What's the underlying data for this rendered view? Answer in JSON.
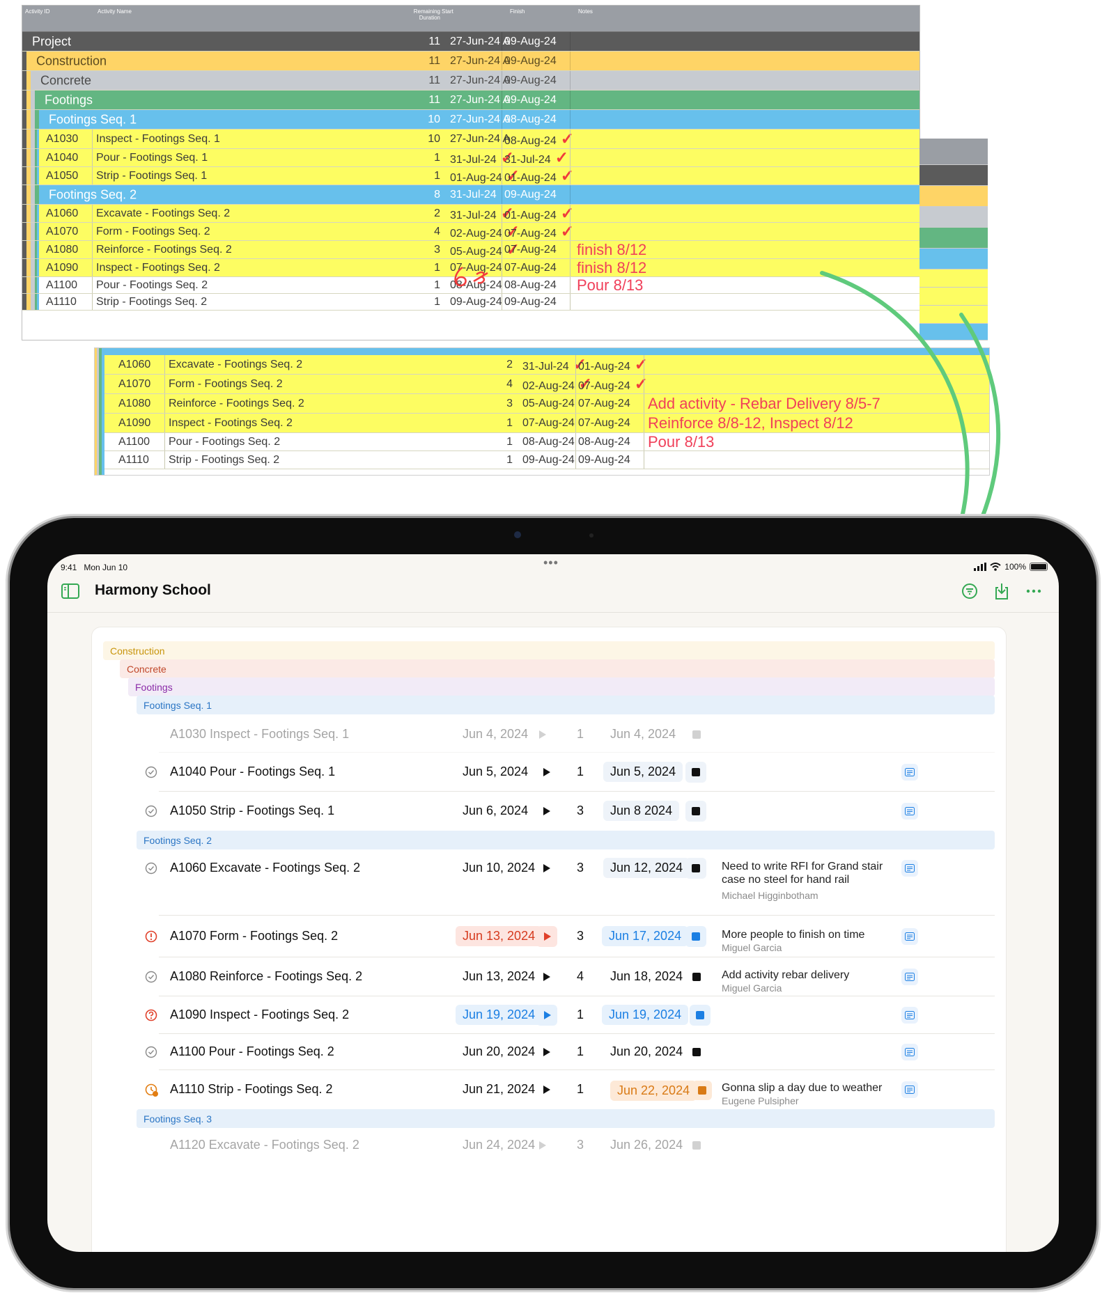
{
  "sheet_top": {
    "headers": [
      "Activity ID",
      "Activity Name",
      "Remaining Duration",
      "Start",
      "Finish",
      "Notes"
    ],
    "rows": [
      {
        "kind": "wbs",
        "name": "Project",
        "dur": "11",
        "start": "27-Jun-24 A",
        "finish": "09-Aug-24",
        "bg": "#5b5b5b",
        "fg": "#ffffff",
        "indent": 0
      },
      {
        "kind": "wbs",
        "name": "Construction",
        "dur": "11",
        "start": "27-Jun-24 A",
        "finish": "09-Aug-24",
        "bg": "#fed466",
        "fg": "#5a4a20",
        "indent": 1
      },
      {
        "kind": "wbs",
        "name": "Concrete",
        "dur": "11",
        "start": "27-Jun-24 A",
        "finish": "09-Aug-24",
        "bg": "#c7cbd0",
        "fg": "#4a4a4a",
        "indent": 2
      },
      {
        "kind": "wbs",
        "name": "Footings",
        "dur": "11",
        "start": "27-Jun-24 A",
        "finish": "09-Aug-24",
        "bg": "#63b682",
        "fg": "#ffffff",
        "indent": 3
      },
      {
        "kind": "wbs",
        "name": "Footings Seq. 1",
        "dur": "10",
        "start": "27-Jun-24 A",
        "finish": "08-Aug-24",
        "bg": "#67c0ec",
        "fg": "#ffffff",
        "indent": 4
      },
      {
        "kind": "act",
        "id": "A1030",
        "name": "Inspect - Footings Seq. 1",
        "dur": "10",
        "start": "27-Jun-24 A",
        "finish": "08-Aug-24",
        "sc": false,
        "fc": true,
        "note": ""
      },
      {
        "kind": "act",
        "id": "A1040",
        "name": "Pour - Footings Seq. 1",
        "dur": "1",
        "start": "31-Jul-24",
        "finish": "31-Jul-24",
        "sc": true,
        "fc": true,
        "note": ""
      },
      {
        "kind": "act",
        "id": "A1050",
        "name": "Strip - Footings Seq. 1",
        "dur": "1",
        "start": "01-Aug-24",
        "finish": "01-Aug-24",
        "sc": true,
        "fc": true,
        "note": ""
      },
      {
        "kind": "wbs",
        "name": "Footings Seq. 2",
        "dur": "8",
        "start": "31-Jul-24",
        "finish": "09-Aug-24",
        "bg": "#67c0ec",
        "fg": "#ffffff",
        "indent": 4
      },
      {
        "kind": "act",
        "id": "A1060",
        "name": "Excavate - Footings Seq. 2",
        "dur": "2",
        "start": "31-Jul-24",
        "finish": "01-Aug-24",
        "sc": true,
        "fc": true,
        "note": ""
      },
      {
        "kind": "act",
        "id": "A1070",
        "name": "Form - Footings Seq. 2",
        "dur": "4",
        "start": "02-Aug-24",
        "finish": "07-Aug-24",
        "sc": true,
        "fc": true,
        "note": ""
      },
      {
        "kind": "act",
        "id": "A1080",
        "name": "Reinforce - Footings Seq. 2",
        "dur": "3",
        "start": "05-Aug-24",
        "finish": "07-Aug-24",
        "sc": true,
        "fc": false,
        "note": "finish 8/12",
        "hand": "6"
      },
      {
        "kind": "act",
        "id": "A1090",
        "name": "Inspect - Footings Seq. 2",
        "dur": "1",
        "start": "07-Aug-24",
        "finish": "07-Aug-24",
        "sc": false,
        "fc": false,
        "note": "finish 8/12"
      },
      {
        "kind": "act",
        "id": "A1100",
        "name": "Pour - Footings Seq. 2",
        "dur": "1",
        "start": "08-Aug-24",
        "finish": "08-Aug-24",
        "sc": false,
        "fc": false,
        "note": "Pour 8/13",
        "white": true
      },
      {
        "kind": "act",
        "id": "A1110",
        "name": "Strip - Footings Seq. 2",
        "dur": "1",
        "start": "09-Aug-24",
        "finish": "09-Aug-24",
        "sc": false,
        "fc": false,
        "note": "",
        "white": true
      }
    ]
  },
  "sheet_bottom": {
    "rows": [
      {
        "id": "A1060",
        "name": "Excavate - Footings Seq. 2",
        "dur": "2",
        "start": "31-Jul-24",
        "finish": "01-Aug-24",
        "sc": true,
        "fc": true,
        "note": ""
      },
      {
        "id": "A1070",
        "name": "Form - Footings Seq. 2",
        "dur": "4",
        "start": "02-Aug-24",
        "finish": "07-Aug-24",
        "sc": true,
        "fc": true,
        "note": ""
      },
      {
        "id": "A1080",
        "name": "Reinforce - Footings Seq. 2",
        "dur": "3",
        "start": "05-Aug-24",
        "finish": "07-Aug-24",
        "sc": false,
        "fc": false,
        "note": "Add activity - Rebar Delivery 8/5-7"
      },
      {
        "id": "A1090",
        "name": "Inspect - Footings Seq. 2",
        "dur": "1",
        "start": "07-Aug-24",
        "finish": "07-Aug-24",
        "sc": false,
        "fc": false,
        "note": "Reinforce 8/8-12, Inspect 8/12"
      },
      {
        "id": "A1100",
        "name": "Pour - Footings Seq. 2",
        "dur": "1",
        "start": "08-Aug-24",
        "finish": "08-Aug-24",
        "sc": false,
        "fc": false,
        "note": "Pour 8/13",
        "white": true
      },
      {
        "id": "A1110",
        "name": "Strip - Footings Seq. 2",
        "dur": "1",
        "start": "09-Aug-24",
        "finish": "09-Aug-24",
        "sc": false,
        "fc": false,
        "note": "",
        "white": true
      }
    ]
  },
  "strip_colors": [
    "#9a9ea4",
    "#5b5b5b",
    "#fed466",
    "#c7cbd0",
    "#63b682",
    "#67c0ec",
    "#fdfd62",
    "#fdfd62",
    "#fdfd62",
    "#67c0ec"
  ],
  "ipad": {
    "status": {
      "time": "9:41",
      "date": "Mon Jun 10",
      "battery": "100%"
    },
    "title": "Harmony School",
    "bands": [
      {
        "label": "Construction",
        "bg": "#fdf6e6",
        "fg": "#c8950c"
      },
      {
        "label": "Concrete",
        "bg": "#fbeae6",
        "fg": "#c0472a"
      },
      {
        "label": "Footings",
        "bg": "#f2ebf7",
        "fg": "#8a2ba8"
      },
      {
        "label": "Footings Seq. 1",
        "bg": "#e6f0fa",
        "fg": "#2a75c4"
      },
      {
        "label": "Footings Seq. 2",
        "bg": "#e6f0fa",
        "fg": "#2a75c4"
      },
      {
        "label": "Footings Seq. 3",
        "bg": "#e6f0fa",
        "fg": "#2a75c4"
      }
    ],
    "activities": [
      {
        "name": "A1030 Inspect - Footings Seq. 1",
        "start": "Jun 4, 2024",
        "dur": "1",
        "finish": "Jun 4, 2024",
        "status": "none",
        "style": "faded",
        "note": "",
        "by": ""
      },
      {
        "name": "A1040 Pour - Footings Seq. 1",
        "start": "Jun 5, 2024",
        "dur": "1",
        "finish": "Jun 5, 2024",
        "status": "done",
        "style": "normal",
        "fpill": true,
        "note": "",
        "by": ""
      },
      {
        "name": "A1050 Strip - Footings Seq. 1",
        "start": "Jun 6, 2024",
        "dur": "3",
        "finish": "Jun 8 2024",
        "status": "done",
        "style": "normal",
        "fpill": true,
        "note": "",
        "by": ""
      },
      {
        "name": "A1060 Excavate - Footings Seq. 2",
        "start": "Jun 10, 2024",
        "dur": "3",
        "finish": "Jun 12, 2024",
        "status": "done",
        "style": "normal",
        "fpill": true,
        "note": "Need to write RFI for Grand stair case no steel for hand rail",
        "by": "Michael Higginbotham"
      },
      {
        "name": "A1070 Form - Footings Seq. 2",
        "start": "Jun 13, 2024",
        "dur": "3",
        "finish": "Jun 17, 2024",
        "status": "alert",
        "style": "red-blue",
        "note": "More people to finish on time",
        "by": "Miguel Garcia"
      },
      {
        "name": "A1080 Reinforce - Footings Seq. 2",
        "start": "Jun 13, 2024",
        "dur": "4",
        "finish": "Jun 18, 2024",
        "status": "done",
        "style": "normal",
        "note": "Add activity rebar delivery",
        "by": "Miguel Garcia"
      },
      {
        "name": "A1090 Inspect - Footings Seq. 2",
        "start": "Jun 19, 2024",
        "dur": "1",
        "finish": "Jun 19, 2024",
        "status": "question",
        "style": "blue-blue",
        "note": "",
        "by": ""
      },
      {
        "name": "A1100 Pour - Footings Seq. 2",
        "start": "Jun 20, 2024",
        "dur": "1",
        "finish": "Jun 20, 2024",
        "status": "done",
        "style": "normal",
        "note": "",
        "by": ""
      },
      {
        "name": "A1110 Strip - Footings Seq. 2",
        "start": "Jun 21, 2024",
        "dur": "1",
        "finish": "Jun 22, 2024",
        "status": "late",
        "style": "orange",
        "note": "Gonna slip a day due to weather",
        "by": "Eugene Pulsipher"
      },
      {
        "name": "A1120 Excavate - Footings Seq. 2",
        "start": "Jun 24, 2024",
        "dur": "3",
        "finish": "Jun 26, 2024",
        "status": "none",
        "style": "faded",
        "note": "",
        "by": ""
      }
    ]
  },
  "colors": {
    "accent_green": "#34a853",
    "arrow": "#5fca7c",
    "check_red": "#f03c3c",
    "note_red": "#f0405a",
    "yellow_row": "#fdfd62"
  }
}
